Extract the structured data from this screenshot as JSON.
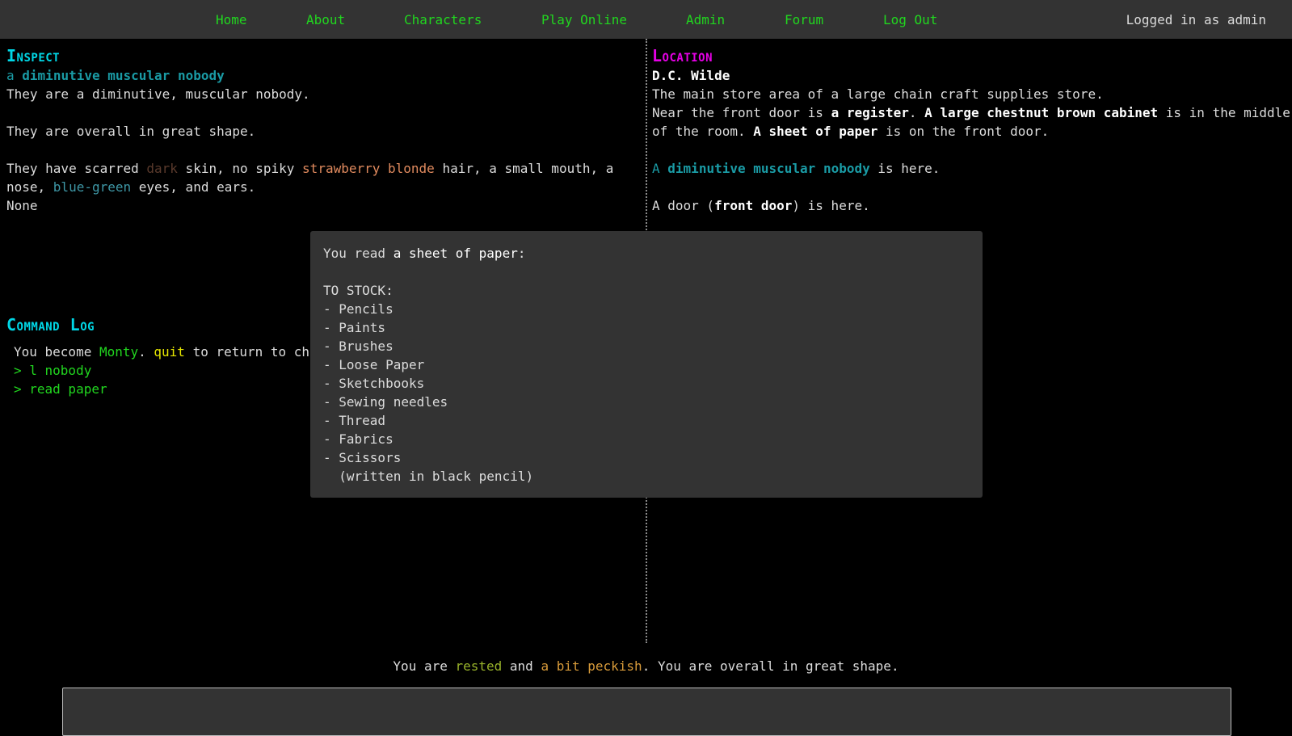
{
  "nav": {
    "items": [
      "Home",
      "About",
      "Characters",
      "Play Online",
      "Admin",
      "Forum",
      "Log Out"
    ],
    "logged_in": "Logged in as admin"
  },
  "inspect": {
    "heading": "Inspect",
    "name_a": "a",
    "name_rest": "diminutive muscular nobody",
    "desc1": "They are a diminutive, muscular nobody.",
    "desc2": "They are overall in great shape.",
    "l3_a": "They have scarred ",
    "l3_dark": "dark",
    "l3_b": " skin, no spiky ",
    "l3_strawberry": "strawberry blonde",
    "l3_c": " hair, a small mouth, a",
    "l4_a": "nose, ",
    "l4_bluegreen": "blue-green",
    "l4_b": " eyes, and ears.",
    "none": "None"
  },
  "location": {
    "heading": "Location",
    "name": "D.C. Wilde",
    "desc": "The main store area of a large chain craft supplies store.",
    "l2_a": "Near the front door is ",
    "l2_register": "a register",
    "l2_b": ". ",
    "l2_cabinet": "A large chestnut brown cabinet",
    "l2_c": " is in the middle",
    "l3_a": "of the room. ",
    "l3_paper": "A sheet of paper",
    "l3_b": " is on the front door.",
    "l4_a": "A",
    "l4_nobody": "diminutive muscular nobody",
    "l4_b": " is here.",
    "l5_a": "A door (",
    "l5_door": "front door",
    "l5_b": ") is here."
  },
  "log": {
    "heading": "Command Log",
    "l1_a": "You become ",
    "l1_monty": "Monty",
    "l1_b": ". ",
    "l1_quit": "quit",
    "l1_c": " to return to ch",
    "cmd1": "> l nobody",
    "cmd2": "> read paper"
  },
  "popup": {
    "intro_a": "You read ",
    "intro_b": "a sheet of paper",
    "intro_c": ":",
    "lines": [
      "TO STOCK:",
      "- Pencils",
      "- Paints",
      "- Brushes",
      "- Loose Paper",
      "- Sketchbooks",
      "- Sewing needles",
      "- Thread",
      "- Fabrics",
      "- Scissors",
      "  (written in black pencil)"
    ]
  },
  "status": {
    "a": "You are ",
    "rested": "rested",
    "b": " and ",
    "peckish": "a bit peckish",
    "c": ". You are overall in great shape."
  }
}
